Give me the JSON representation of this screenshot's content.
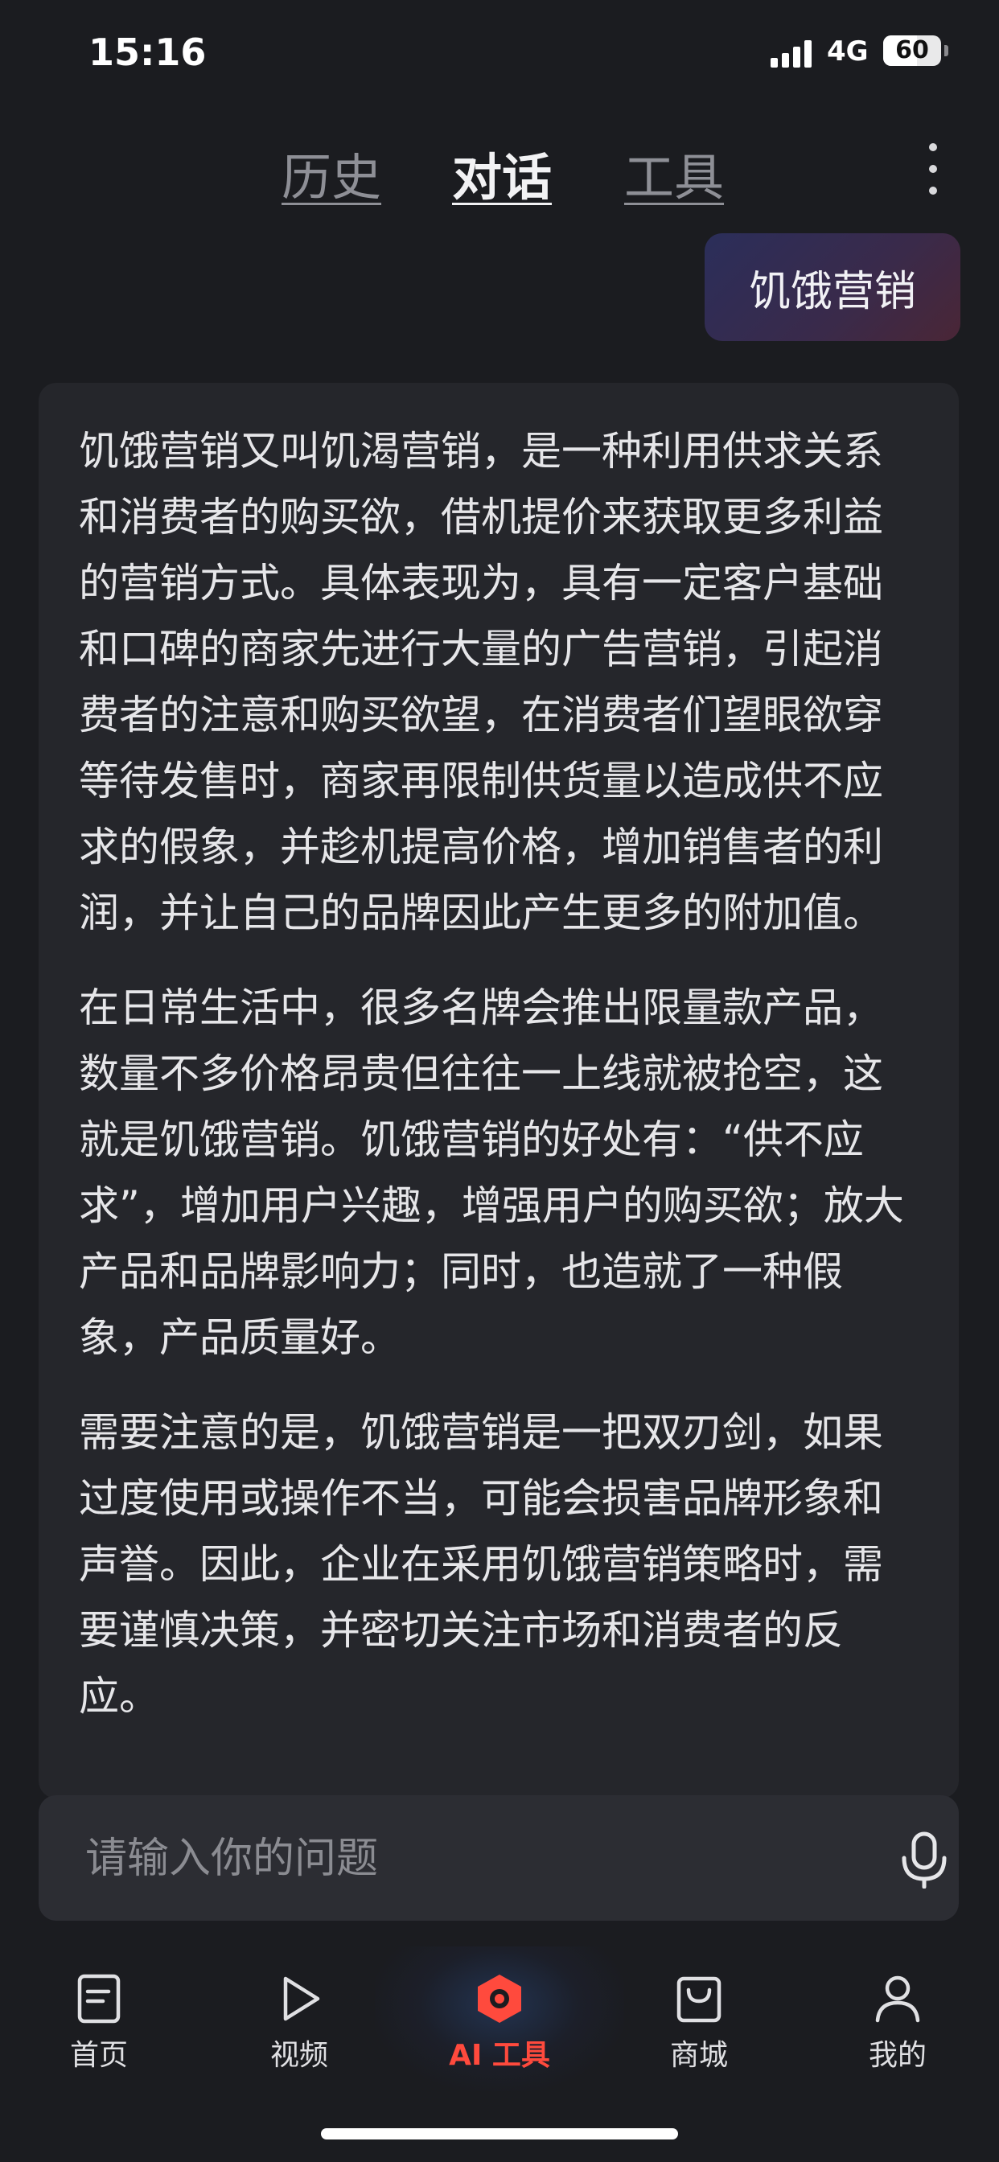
{
  "status_bar": {
    "time": "15:16",
    "network": "4G",
    "battery": "60"
  },
  "tabs": [
    {
      "label": "历史",
      "active": false
    },
    {
      "label": "对话",
      "active": true
    },
    {
      "label": "工具",
      "active": false
    }
  ],
  "conversation": {
    "user_message": "饥饿营销",
    "answer_paragraphs": [
      "饥饿营销又叫饥渴营销，是一种利用供求关系和消费者的购买欲，借机提价来获取更多利益的营销方式。具体表现为，具有一定客户基础和口碑的商家先进行大量的广告营销，引起消费者的注意和购买欲望，在消费者们望眼欲穿等待发售时，商家再限制供货量以造成供不应求的假象，并趁机提高价格，增加销售者的利润，并让自己的品牌因此产生更多的附加值。",
      "在日常生活中，很多名牌会推出限量款产品，数量不多价格昂贵但往往一上线就被抢空，这就是饥饿营销。饥饿营销的好处有：“供不应求”，增加用户兴趣，增强用户的购买欲；放大产品和品牌影响力；同时，也造就了一种假象，产品质量好。",
      "需要注意的是，饥饿营销是一把双刃剑，如果过度使用或操作不当，可能会损害品牌形象和声誉。因此，企业在采用饥饿营销策略时，需要谨慎决策，并密切关注市场和消费者的反应。"
    ]
  },
  "input": {
    "placeholder": "请输入你的问题",
    "value": ""
  },
  "bottom_nav": [
    {
      "label": "首页",
      "icon": "document-icon",
      "active": false
    },
    {
      "label": "视频",
      "icon": "play-icon",
      "active": false
    },
    {
      "label": "AI 工具",
      "icon": "ai-hexagon-icon",
      "active": true
    },
    {
      "label": "商城",
      "icon": "shopping-bag-icon",
      "active": false
    },
    {
      "label": "我的",
      "icon": "person-icon",
      "active": false
    }
  ],
  "colors": {
    "accent": "#ff4a3d",
    "background": "#1b1c20",
    "card": "#25262b"
  }
}
